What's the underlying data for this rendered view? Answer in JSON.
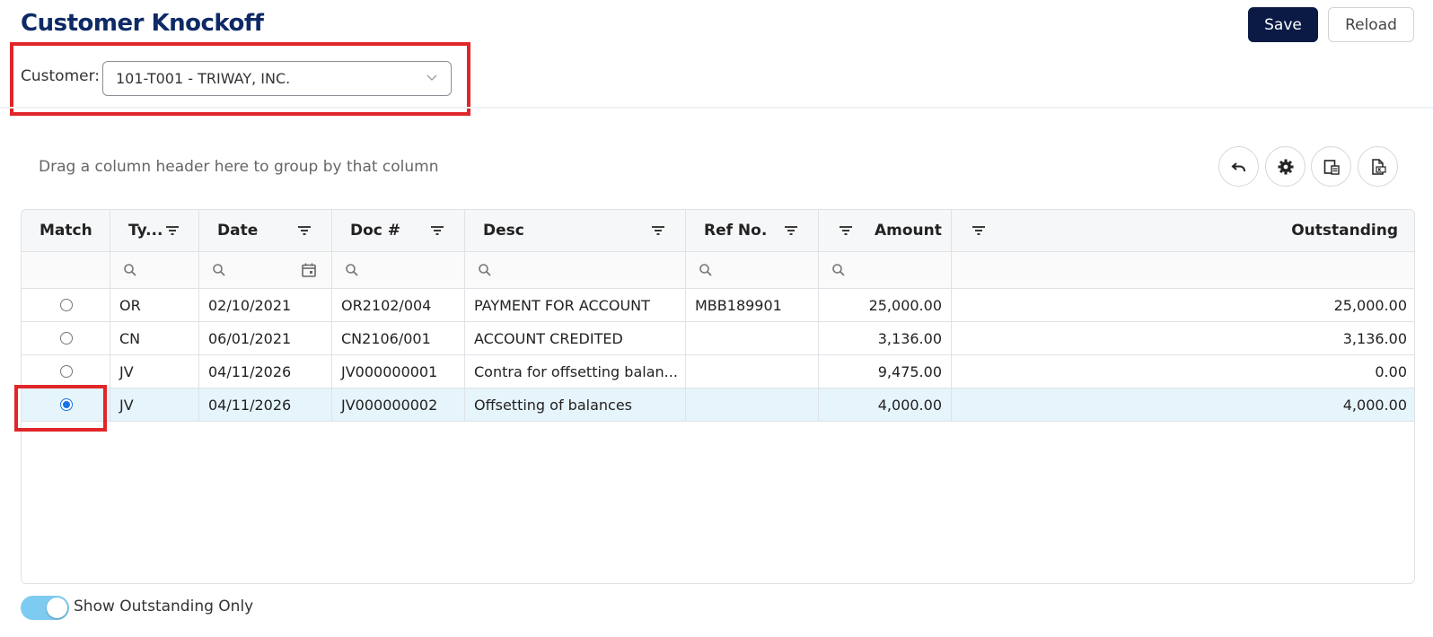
{
  "page": {
    "title": "Customer Knockoff"
  },
  "toolbar": {
    "save_label": "Save",
    "reload_label": "Reload"
  },
  "customer": {
    "label": "Customer:",
    "value": "101-T001 - TRIWAY, INC."
  },
  "grid": {
    "group_hint": "Drag a column header here to group by that column",
    "columns": {
      "match": "Match",
      "type": "Ty...",
      "date": "Date",
      "doc": "Doc #",
      "desc": "Desc",
      "ref": "Ref No.",
      "amount": "Amount",
      "outstanding": "Outstanding"
    },
    "rows": [
      {
        "type": "OR",
        "date": "02/10/2021",
        "doc": "OR2102/004",
        "desc": "PAYMENT FOR ACCOUNT",
        "ref": "MBB189901",
        "amount": "25,000.00",
        "outstanding": "25,000.00",
        "selected": false
      },
      {
        "type": "CN",
        "date": "06/01/2021",
        "doc": "CN2106/001",
        "desc": "ACCOUNT CREDITED",
        "ref": "",
        "amount": "3,136.00",
        "outstanding": "3,136.00",
        "selected": false
      },
      {
        "type": "JV",
        "date": "04/11/2026",
        "doc": "JV000000001",
        "desc": "Contra for offsetting balan...",
        "ref": "",
        "amount": "9,475.00",
        "outstanding": "0.00",
        "selected": false
      },
      {
        "type": "JV",
        "date": "04/11/2026",
        "doc": "JV000000002",
        "desc": "Offsetting of balances",
        "ref": "",
        "amount": "4,000.00",
        "outstanding": "4,000.00",
        "selected": true
      }
    ]
  },
  "footer": {
    "toggle_label": "Show Outstanding Only",
    "toggle_on": true
  },
  "colors": {
    "title": "#0e2a66",
    "save_bg": "#0b1a45",
    "link": "#1ba5dc",
    "selected_row": "#e6f4fb",
    "highlight": "#e0262a",
    "toggle": "#7dcbf0"
  },
  "icons": {
    "filter": "filter-icon",
    "search": "search-icon",
    "calendar": "calendar-icon",
    "undo": "undo-icon",
    "gear": "gear-icon",
    "columns": "column-chooser-icon",
    "export": "export-excel-icon",
    "chevron": "chevron-down-icon"
  }
}
